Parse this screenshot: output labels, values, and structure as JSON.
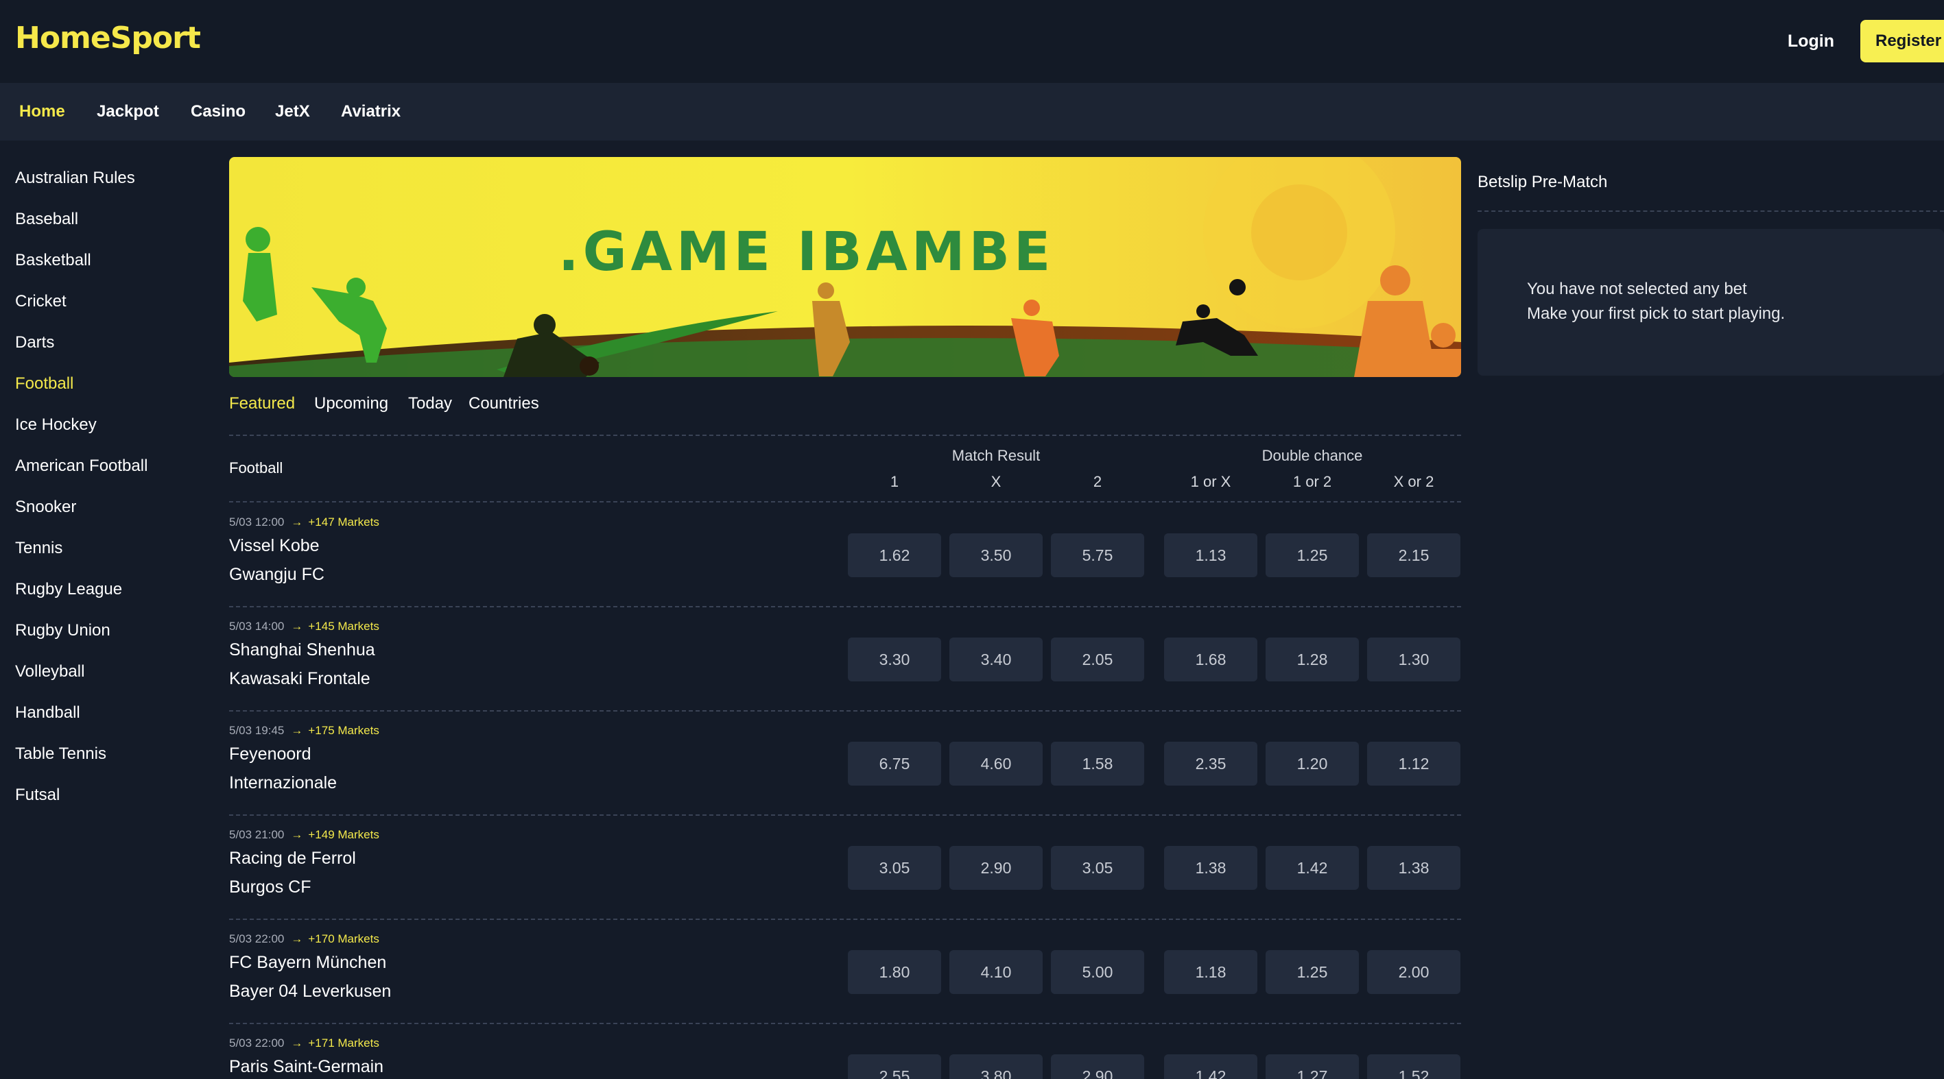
{
  "header": {
    "logo": "HomeSport",
    "login_label": "Login",
    "register_label": "Register"
  },
  "nav": {
    "items": [
      {
        "label": "Home",
        "active": true
      },
      {
        "label": "Jackpot"
      },
      {
        "label": "Casino"
      },
      {
        "label": "JetX"
      },
      {
        "label": "Aviatrix"
      }
    ]
  },
  "sidebar": {
    "items": [
      {
        "label": "Australian Rules"
      },
      {
        "label": "Baseball"
      },
      {
        "label": "Basketball"
      },
      {
        "label": "Cricket"
      },
      {
        "label": "Darts"
      },
      {
        "label": "Football",
        "active": true
      },
      {
        "label": "Ice Hockey"
      },
      {
        "label": "American Football"
      },
      {
        "label": "Snooker"
      },
      {
        "label": "Tennis"
      },
      {
        "label": "Rugby League"
      },
      {
        "label": "Rugby Union"
      },
      {
        "label": "Volleyball"
      },
      {
        "label": "Handball"
      },
      {
        "label": "Table Tennis"
      },
      {
        "label": "Futsal"
      }
    ]
  },
  "banner": {
    "text": ".GAME IBAMBE",
    "colors": {
      "background": "#f6e93a",
      "text": "#2e8b3e"
    }
  },
  "tabs": [
    {
      "label": "Featured",
      "active": true
    },
    {
      "label": "Upcoming"
    },
    {
      "label": "Today"
    },
    {
      "label": "Countries"
    }
  ],
  "table": {
    "sport": "Football",
    "groups": [
      {
        "label": "Match Result"
      },
      {
        "label": "Double chance"
      }
    ],
    "columns": [
      "1",
      "X",
      "2",
      "1 or X",
      "1 or 2",
      "X or 2"
    ],
    "matches": [
      {
        "time": "5/03 12:00",
        "markets": "+147 Markets",
        "home": "Vissel Kobe",
        "away": "Gwangju FC",
        "odds": [
          "1.62",
          "3.50",
          "5.75",
          "1.13",
          "1.25",
          "2.15"
        ]
      },
      {
        "time": "5/03 14:00",
        "markets": "+145 Markets",
        "home": "Shanghai Shenhua",
        "away": "Kawasaki Frontale",
        "odds": [
          "3.30",
          "3.40",
          "2.05",
          "1.68",
          "1.28",
          "1.30"
        ]
      },
      {
        "time": "5/03 19:45",
        "markets": "+175 Markets",
        "home": "Feyenoord",
        "away": "Internazionale",
        "odds": [
          "6.75",
          "4.60",
          "1.58",
          "2.35",
          "1.20",
          "1.12"
        ]
      },
      {
        "time": "5/03 21:00",
        "markets": "+149 Markets",
        "home": "Racing de Ferrol",
        "away": "Burgos CF",
        "odds": [
          "3.05",
          "2.90",
          "3.05",
          "1.38",
          "1.42",
          "1.38"
        ]
      },
      {
        "time": "5/03 22:00",
        "markets": "+170 Markets",
        "home": "FC Bayern München",
        "away": "Bayer 04 Leverkusen",
        "odds": [
          "1.80",
          "4.10",
          "5.00",
          "1.18",
          "1.25",
          "2.00"
        ]
      },
      {
        "time": "5/03 22:00",
        "markets": "+171 Markets",
        "home": "Paris Saint-Germain",
        "away": "",
        "odds": [
          "2.55",
          "3.80",
          "2.90",
          "1.42",
          "1.27",
          "1.52"
        ]
      }
    ]
  },
  "betslip": {
    "title": "Betslip Pre-Match",
    "empty_line1": "You have not selected any bet",
    "empty_line2": "Make your first pick to start playing."
  },
  "colors": {
    "accent": "#f4e94b",
    "background": "#141b28",
    "panel": "#1c2433",
    "odd_button": "#232c3d"
  }
}
